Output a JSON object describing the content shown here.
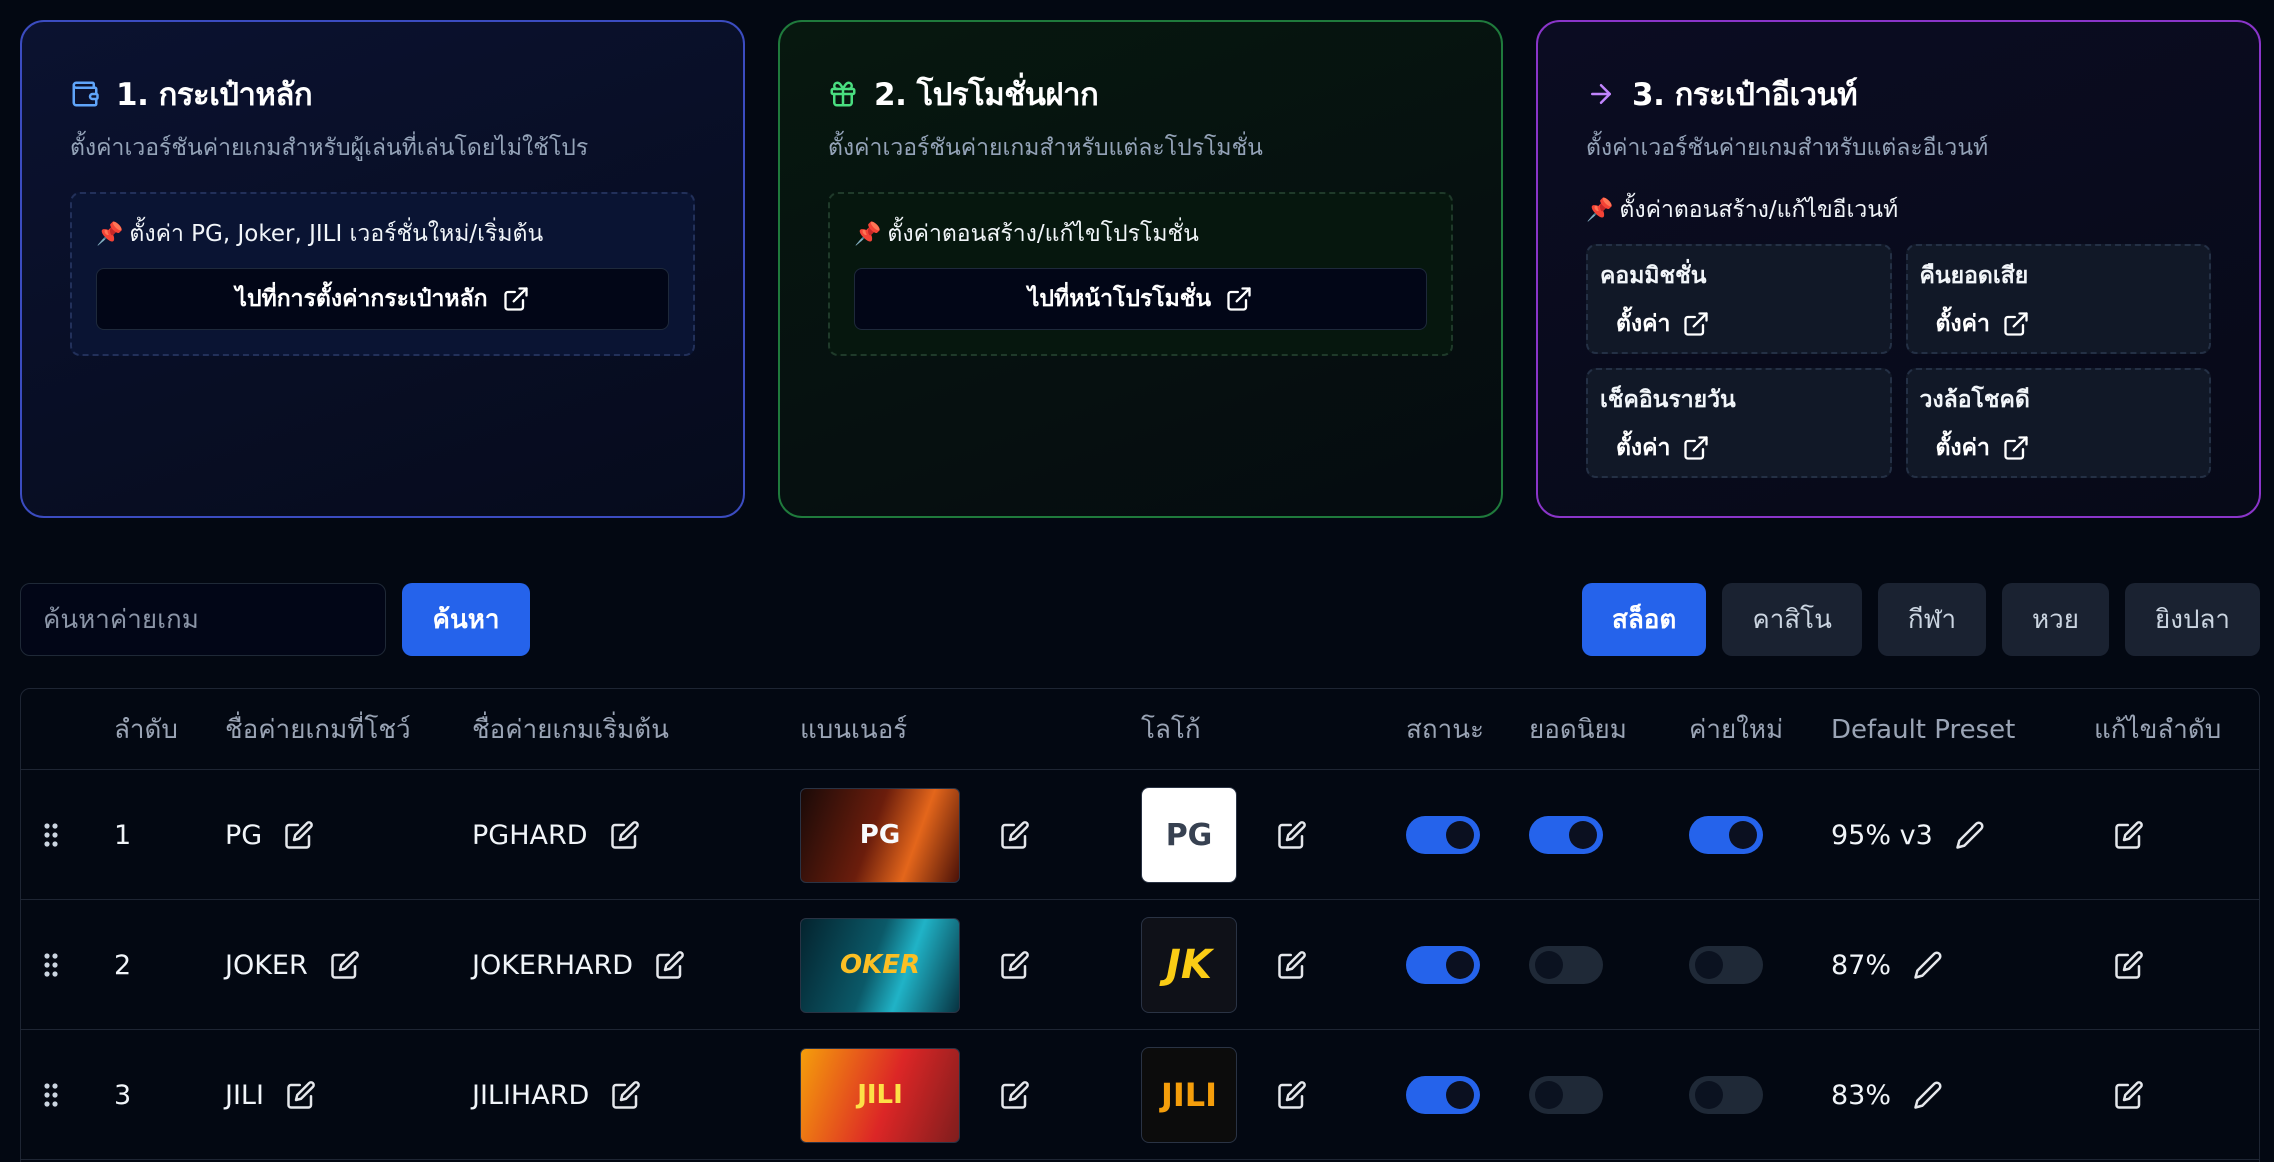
{
  "cards": [
    {
      "title": "1. กระเป๋าหลัก",
      "subtitle": "ตั้งค่าเวอร์ชันค่ายเกมสำหรับผู้เล่นที่เล่นโดยไม่ใช้โปร",
      "note": "ตั้งค่า PG, Joker, JILI เวอร์ชั่นใหม่/เริ่มต้น",
      "button": "ไปที่การตั้งค่ากระเป๋าหลัก",
      "icon": "wallet-icon",
      "accent": "#3b4cc0"
    },
    {
      "title": "2. โปรโมชั่นฝาก",
      "subtitle": "ตั้งค่าเวอร์ชันค่ายเกมสำหรับแต่ละโปรโมชั่น",
      "note": "ตั้งค่าตอนสร้าง/แก้ไขโปรโมชั่น",
      "button": "ไปที่หน้าโปรโมชั่น",
      "icon": "gift-icon",
      "accent": "#1f7a3c"
    },
    {
      "title": "3. กระเป๋าอีเวนท์",
      "subtitle": "ตั้งค่าเวอร์ชันค่ายเกมสำหรับแต่ละอีเวนท์",
      "note": "ตั้งค่าตอนสร้าง/แก้ไขอีเวนท์",
      "icon": "arrow-right-icon",
      "accent": "#8a35c9",
      "events": [
        {
          "name": "คอมมิชชั่น",
          "action": "ตั้งค่า"
        },
        {
          "name": "คืนยอดเสีย",
          "action": "ตั้งค่า"
        },
        {
          "name": "เช็คอินรายวัน",
          "action": "ตั้งค่า"
        },
        {
          "name": "วงล้อโชคดี",
          "action": "ตั้งค่า"
        }
      ]
    }
  ],
  "search": {
    "placeholder": "ค้นหาค่ายเกม",
    "value": "",
    "button": "ค้นหา"
  },
  "tabs": [
    "สล็อต",
    "คาสิโน",
    "กีฬา",
    "หวย",
    "ยิงปลา"
  ],
  "active_tab": "สล็อต",
  "table": {
    "headers": [
      "ลำดับ",
      "ชื่อค่ายเกมที่โชว์",
      "ชื่อค่ายเกมเริ่มต้น",
      "แบนเนอร์",
      "โลโก้",
      "สถานะ",
      "ยอดนิยม",
      "ค่ายใหม่",
      "Default Preset",
      "แก้ไขลำดับ"
    ],
    "rows": [
      {
        "order": "1",
        "display_name": "PG",
        "original_name": "PGHARD",
        "banner_text": "PG",
        "logo_text": "PG",
        "status": true,
        "popular": true,
        "new": true,
        "preset": "95% v3"
      },
      {
        "order": "2",
        "display_name": "JOKER",
        "original_name": "JOKERHARD",
        "banner_text": "OKER",
        "logo_text": "JK",
        "status": true,
        "popular": false,
        "new": false,
        "preset": "87%"
      },
      {
        "order": "3",
        "display_name": "JILI",
        "original_name": "JILIHARD",
        "banner_text": "JILI",
        "logo_text": "JILI",
        "status": true,
        "popular": false,
        "new": false,
        "preset": "83%"
      }
    ]
  }
}
